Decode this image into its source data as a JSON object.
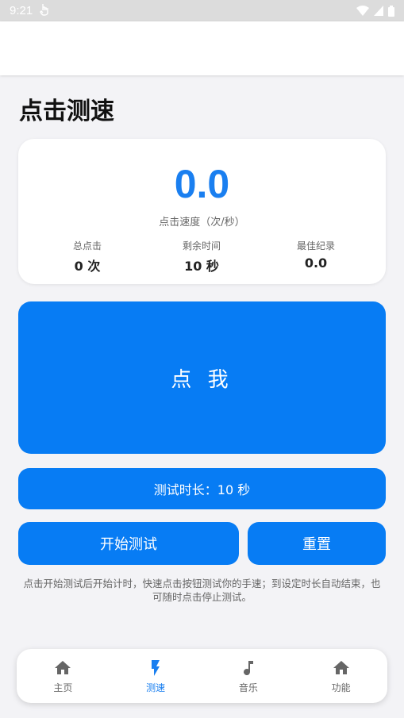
{
  "status_bar": {
    "time": "9:21"
  },
  "title": "点击测速",
  "stats": {
    "speed_value": "0.0",
    "speed_label": "点击速度（次/秒）",
    "total_clicks_label": "总点击",
    "total_clicks_value": "0 次",
    "remaining_label": "剩余时间",
    "remaining_value": "10 秒",
    "best_label": "最佳纪录",
    "best_value": "0.0"
  },
  "tap_button_label": "点 我",
  "duration_button_label": "测试时长：10 秒",
  "start_button_label": "开始测试",
  "reset_button_label": "重置",
  "hint": "点击开始测试后开始计时，快速点击按钮测试你的手速；到设定时长自动结束，也可随时点击停止测试。",
  "nav": {
    "items": [
      {
        "label": "主页",
        "icon": "home-icon",
        "active": false
      },
      {
        "label": "测速",
        "icon": "bolt-icon",
        "active": true
      },
      {
        "label": "音乐",
        "icon": "music-note-icon",
        "active": false
      },
      {
        "label": "功能",
        "icon": "home-icon",
        "active": false
      }
    ]
  },
  "colors": {
    "accent": "#077cf4",
    "active_nav": "#1a7ff0",
    "inactive_icon": "#666666"
  }
}
